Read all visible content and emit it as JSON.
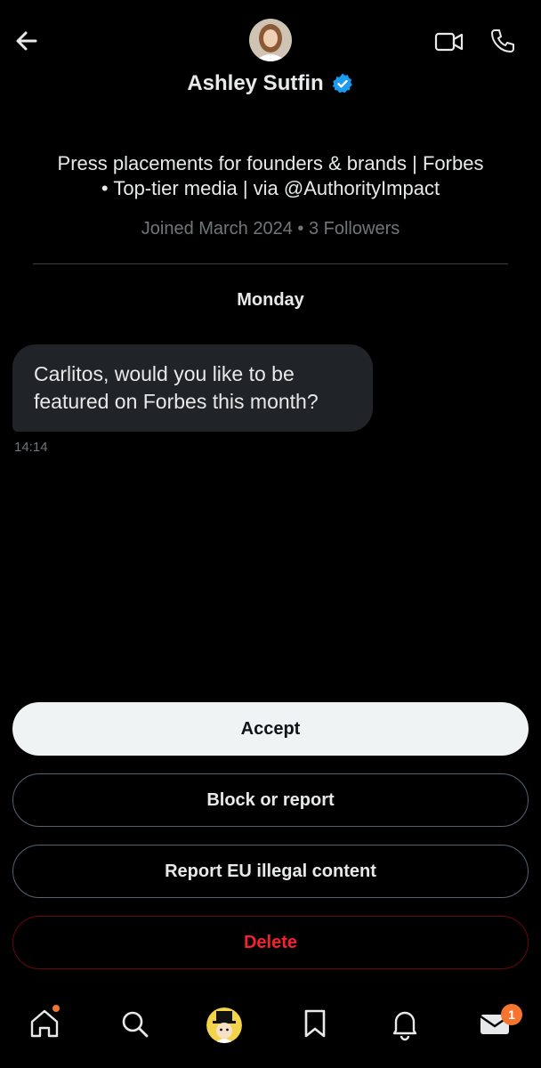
{
  "header": {
    "name": "Ashley Sutfin",
    "back_icon": "arrow-left-icon",
    "video_icon": "video-camera-icon",
    "phone_icon": "phone-icon",
    "verified_icon": "verified-badge-icon",
    "verified_color": "#1d9bf0"
  },
  "profile": {
    "bio_line1": "Press placements for founders & brands | Forbes",
    "bio_line2": "• Top-tier media | via @AuthorityImpact",
    "meta": "Joined March 2024 • 3 Followers"
  },
  "conversation": {
    "day_label": "Monday",
    "messages": [
      {
        "line1": "Carlitos, would you like to be",
        "line2": "featured on Forbes this month?",
        "time": "14:14"
      }
    ]
  },
  "actions": {
    "accept": "Accept",
    "block_report": "Block or report",
    "report_eu": "Report EU illegal content",
    "delete": "Delete",
    "delete_color": "#f4212e"
  },
  "tabbar": {
    "items": [
      "home-icon",
      "search-icon",
      "profile-avatar",
      "bookmark-icon",
      "bell-icon",
      "mail-icon"
    ],
    "mail_badge": "1",
    "badge_color": "#f7742f"
  }
}
